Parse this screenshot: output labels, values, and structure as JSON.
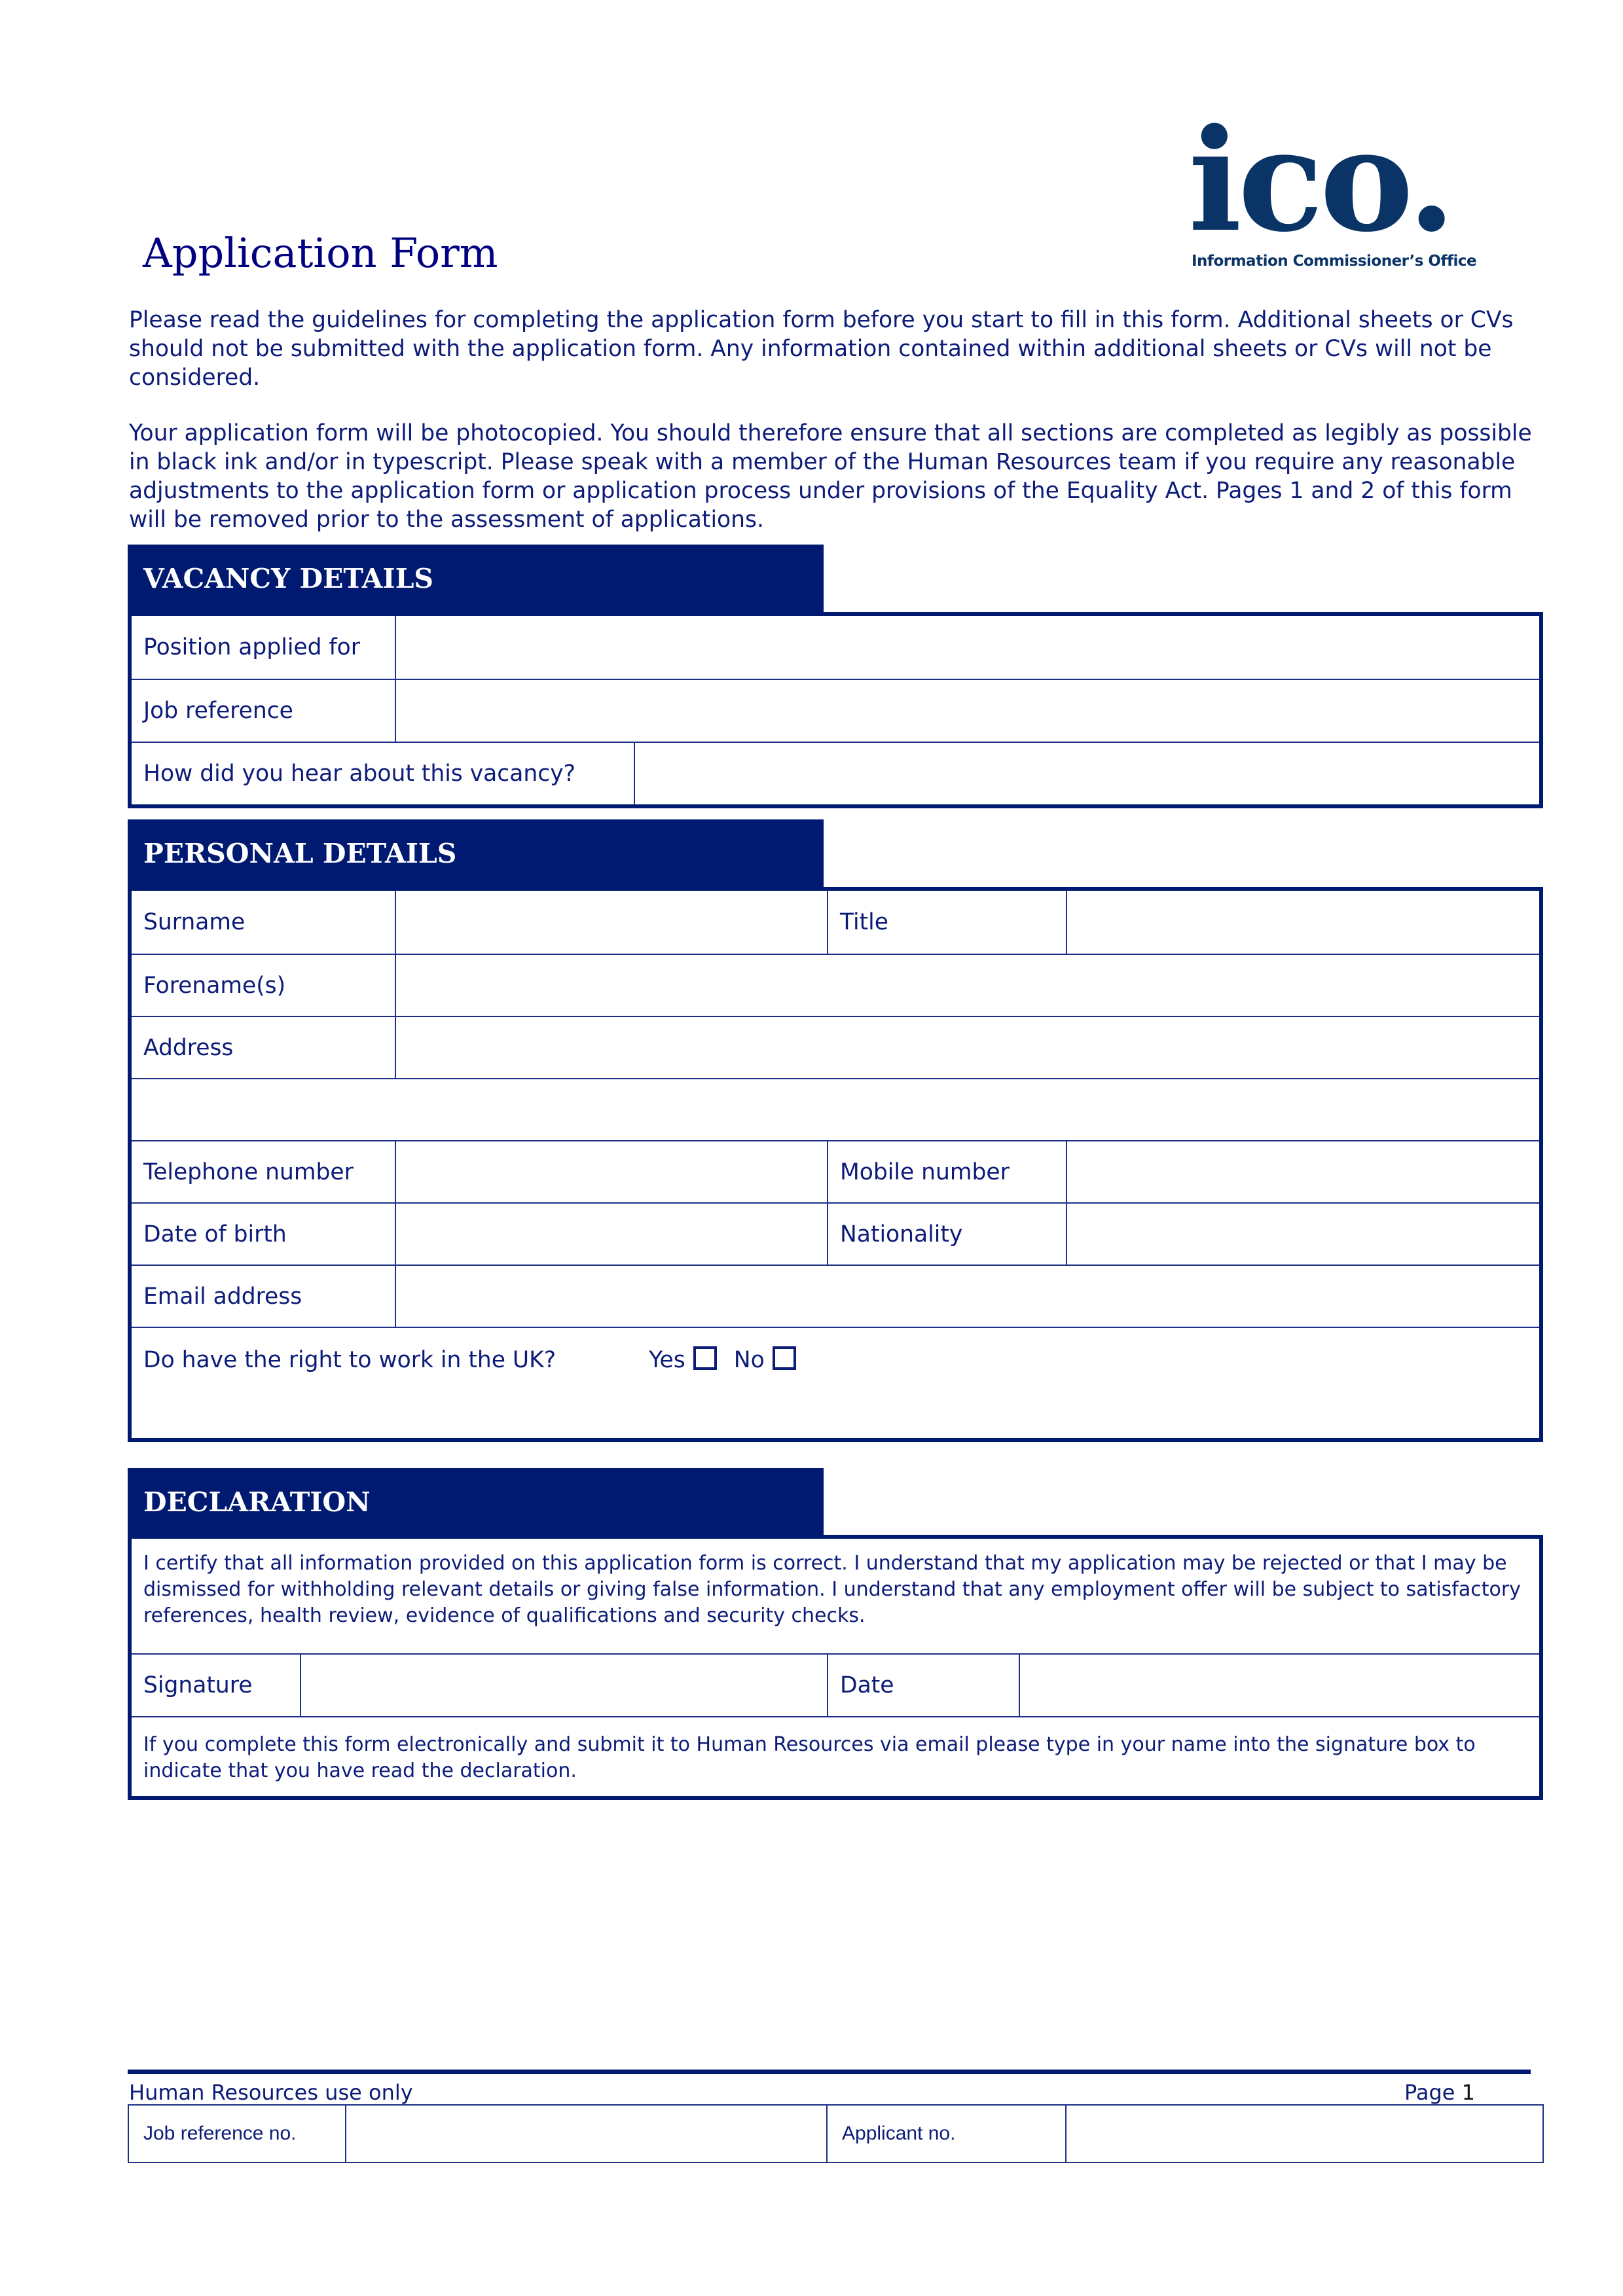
{
  "logo": {
    "mark": "ico.",
    "subtitle": "Information Commissioner’s Office",
    "color": "#0a3366"
  },
  "title": "Application Form",
  "intro": {
    "paragraph1": "Please read the guidelines for completing the application form before you start to fill in this form. Additional sheets or CVs should not be submitted with the application form. Any information contained within additional sheets or CVs will not be considered.",
    "paragraph2": "Your application form will be photocopied. You should therefore ensure that all sections are completed as legibly as possible in black ink and/or in typescript.  Please speak with a member of the Human Resources team if you require any reasonable adjustments to the application form or application process under provisions of the Equality Act.  Pages 1 and 2 of this form will be removed prior to the assessment of applications."
  },
  "colors": {
    "header_bar": "#001a72",
    "text": "#0c1c78",
    "title": "#000080"
  },
  "vacancy": {
    "heading": "VACANCY DETAILS",
    "fields": {
      "position": {
        "label": "Position applied for",
        "value": ""
      },
      "job_reference": {
        "label": "Job reference",
        "value": ""
      },
      "heard_about": {
        "label": "How did you hear about this vacancy?",
        "value": ""
      }
    }
  },
  "personal": {
    "heading": "PERSONAL DETAILS",
    "fields": {
      "surname": {
        "label": "Surname",
        "value": ""
      },
      "title": {
        "label": "Title",
        "value": ""
      },
      "forenames": {
        "label": "Forename(s)",
        "value": ""
      },
      "address": {
        "label": "Address",
        "value": ""
      },
      "address_line2": {
        "value": ""
      },
      "telephone": {
        "label": "Telephone number",
        "value": ""
      },
      "mobile": {
        "label": "Mobile number",
        "value": ""
      },
      "dob": {
        "label": "Date of birth",
        "value": ""
      },
      "nationality": {
        "label": "Nationality",
        "value": ""
      },
      "email": {
        "label": "Email address",
        "value": ""
      }
    },
    "right_to_work": {
      "question": "Do have the right to work in the UK?",
      "yes_label": "Yes",
      "no_label": "No",
      "yes_checked": false,
      "no_checked": false
    }
  },
  "declaration": {
    "heading": "DECLARATION",
    "statement": "I certify that all information provided on this application form is correct. I understand that my application may be rejected or that I may be dismissed for withholding relevant details or giving false information. I understand that any employment offer will be subject to satisfactory references, health review, evidence of qualifications and security checks.",
    "signature": {
      "label": "Signature",
      "value": ""
    },
    "date": {
      "label": "Date",
      "value": ""
    },
    "note": "If you complete this form electronically and submit it to Human Resources via email please type in your name into the signature box to indicate that you have read the declaration."
  },
  "footer": {
    "label": "Human Resources use only",
    "page_label": "Page",
    "page_number": "1",
    "job_ref": {
      "label": "Job reference no.",
      "value": ""
    },
    "applicant": {
      "label": "Applicant no.",
      "value": ""
    }
  }
}
